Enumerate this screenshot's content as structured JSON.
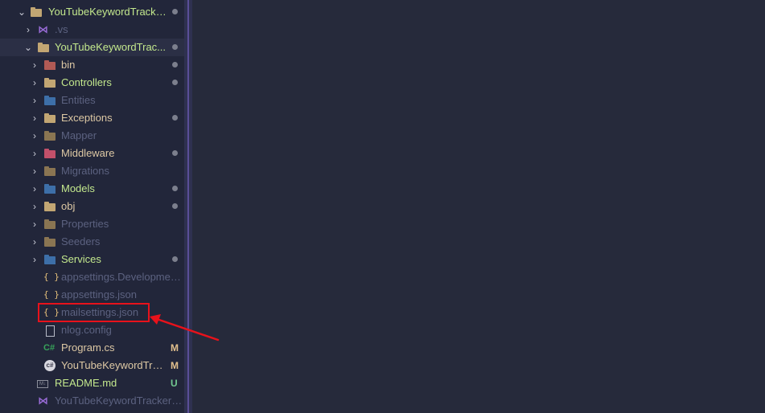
{
  "explorer": {
    "rows": [
      {
        "label": "YouTubeKeywordTracke...",
        "color": "#c3e88d",
        "indicator": "dot",
        "expanded": true,
        "icon": "folder-open-icon"
      },
      {
        "label": ".vs",
        "color": "#5c6280",
        "expanded": false,
        "icon": "vs-folder-icon"
      },
      {
        "label": "YouTubeKeywordTrac...",
        "color": "#c3e88d",
        "indicator": "dot",
        "expanded": true,
        "icon": "folder-open-icon"
      },
      {
        "label": "bin",
        "color": "#ddc8a4",
        "indicator": "dot",
        "icon": "bin-folder-icon"
      },
      {
        "label": "Controllers",
        "color": "#c3e88d",
        "indicator": "dot",
        "icon": "controllers-folder-icon"
      },
      {
        "label": "Entities",
        "color": "#5c6280",
        "icon": "entities-folder-icon"
      },
      {
        "label": "Exceptions",
        "color": "#ddc8a4",
        "indicator": "dot",
        "icon": "folder-icon"
      },
      {
        "label": "Mapper",
        "color": "#5c6280",
        "icon": "folder-icon"
      },
      {
        "label": "Middleware",
        "color": "#ddc8a4",
        "indicator": "dot",
        "icon": "middleware-folder-icon"
      },
      {
        "label": "Migrations",
        "color": "#5c6280",
        "icon": "folder-icon"
      },
      {
        "label": "Models",
        "color": "#c3e88d",
        "indicator": "dot",
        "icon": "models-folder-icon"
      },
      {
        "label": "obj",
        "color": "#ddc8a4",
        "indicator": "dot",
        "icon": "folder-icon"
      },
      {
        "label": "Properties",
        "color": "#5c6280",
        "icon": "folder-icon"
      },
      {
        "label": "Seeders",
        "color": "#5c6280",
        "icon": "folder-icon"
      },
      {
        "label": "Services",
        "color": "#c3e88d",
        "indicator": "dot",
        "icon": "services-folder-icon"
      },
      {
        "label": "appsettings.Development.j...",
        "color": "#5c6280",
        "icon": "json-icon"
      },
      {
        "label": "appsettings.json",
        "color": "#5c6280",
        "icon": "json-icon"
      },
      {
        "label": "mailsettings.json",
        "color": "#5c6280",
        "icon": "json-icon"
      },
      {
        "label": "nlog.config",
        "color": "#5c6280",
        "icon": "file-icon"
      },
      {
        "label": "Program.cs",
        "color": "#ddc8a4",
        "badge": "M",
        "badgeColor": "#e2c08d",
        "icon": "csharp-icon"
      },
      {
        "label": "YouTubeKeywordTra...",
        "color": "#ddc8a4",
        "badge": "M",
        "badgeColor": "#e2c08d",
        "icon": "csproj-icon"
      },
      {
        "label": "README.md",
        "color": "#c3e88d",
        "badge": "U",
        "badgeColor": "#73c991",
        "icon": "markdown-icon"
      },
      {
        "label": "YouTubeKeywordTrackerAPI...",
        "color": "#5c6280",
        "icon": "vs-solution-icon"
      }
    ]
  },
  "glyphs": {
    "chevron_right": "›",
    "chevron_down": "⌄",
    "json": "{ }",
    "csharp": "C#",
    "vs": "⋈",
    "md": "M↓"
  },
  "colors": {
    "highlight": "#e8121b",
    "accent_scroll": "#5a4f98"
  }
}
